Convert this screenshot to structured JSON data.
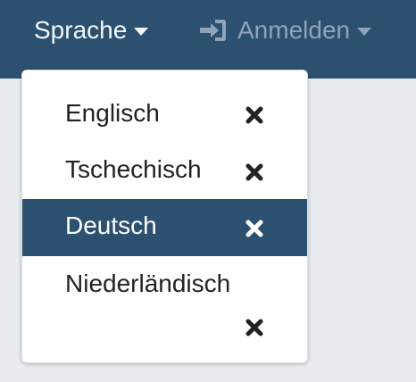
{
  "navbar": {
    "language_label": "Sprache",
    "login_label": "Anmelden"
  },
  "language_menu": {
    "items": [
      {
        "label": "Englisch",
        "active": false
      },
      {
        "label": "Tschechisch",
        "active": false
      },
      {
        "label": "Deutsch",
        "active": true
      },
      {
        "label": "Niederländisch",
        "active": false
      }
    ]
  },
  "colors": {
    "navbar_bg": "#2c5070",
    "active_item_bg": "#2c5070",
    "page_bg": "#e9ecef"
  },
  "icons": {
    "remove": "close-icon",
    "login": "sign-in-icon",
    "caret": "chevron-down-icon"
  }
}
